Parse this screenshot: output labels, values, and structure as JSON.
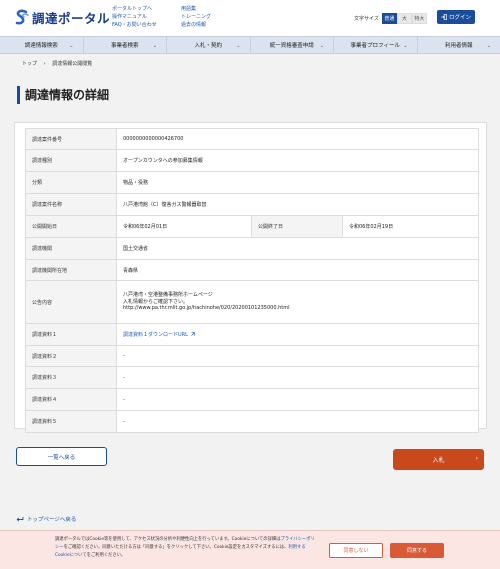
{
  "header": {
    "logo_text": "調達ポータル",
    "links_col1": [
      "ポータルトップへ",
      "操作マニュアル",
      "FAQ・お問い合わせ"
    ],
    "links_col2": [
      "用語集",
      "トレーニング",
      "過去の情報"
    ],
    "font_size_label": "文字サイズ",
    "font_sizes": [
      "普通",
      "大",
      "特大"
    ],
    "login_label": "ログイン"
  },
  "nav": {
    "items": [
      "調達情報検索",
      "事業者検索",
      "入札・契約",
      "統一資格審査申請",
      "事業者プロフィール",
      "利用者情報"
    ]
  },
  "breadcrumb": {
    "home": "トップ",
    "current": "調達情報公開閲覧"
  },
  "page_title": "調達情報の詳細",
  "detail": {
    "case_no_label": "調達案件番号",
    "case_no": "0000000000000426700",
    "type_label": "調達種別",
    "type": "オープンカウンタへの参加募集情報",
    "category_label": "分類",
    "category": "物品・役務",
    "name_label": "調達案件名称",
    "name": "八戸港湾館（C）復舎ガス警報器取替",
    "start_label": "公開開始日",
    "start": "令和06年02月01日",
    "end_label": "公開終了日",
    "end": "令和06年02月19日",
    "agency_label": "調達機関",
    "agency": "国土交通省",
    "location_label": "調達機関所在地",
    "location": "青森県",
    "content_label": "公告内容",
    "content_lines": [
      "八戸港湾・空港整備事務所ホームページ",
      "入札情報からご確認下さい。",
      "http://www.pa.thr.mlit.go.jp/hachinohe/020/20200101235000.html"
    ],
    "doc1_label": "調達資料１",
    "doc1_link": "調達資料１ダウンロードURL",
    "doc2_label": "調達資料２",
    "doc2": "-",
    "doc3_label": "調達資料３",
    "doc3": "-",
    "doc4_label": "調達資料４",
    "doc4": "-",
    "doc5_label": "調達資料５",
    "doc5": "-"
  },
  "buttons": {
    "back": "一覧へ戻る",
    "apply": "入札"
  },
  "page_top": "トップページへ戻る",
  "cookie": {
    "text_before_policy": "調達ポータルではCookie等を使用して、アクセス状況の分析や利便性向上を行っています。Cookieについての詳細は",
    "policy_link": "プライバシーポリシー",
    "text_mid": "をご確認ください。同意いただける方は「同意する」をクリックして下さい。Cookie設定をカスタマイズするには、",
    "settings_link": "利用するCookieについて",
    "text_after": "をご利用ください。",
    "disagree": "同意しない",
    "agree": "同意する"
  },
  "colors": {
    "brand": "#1a4c9c",
    "accent": "#c9481c",
    "cookie_bg": "#fbe6e3"
  }
}
